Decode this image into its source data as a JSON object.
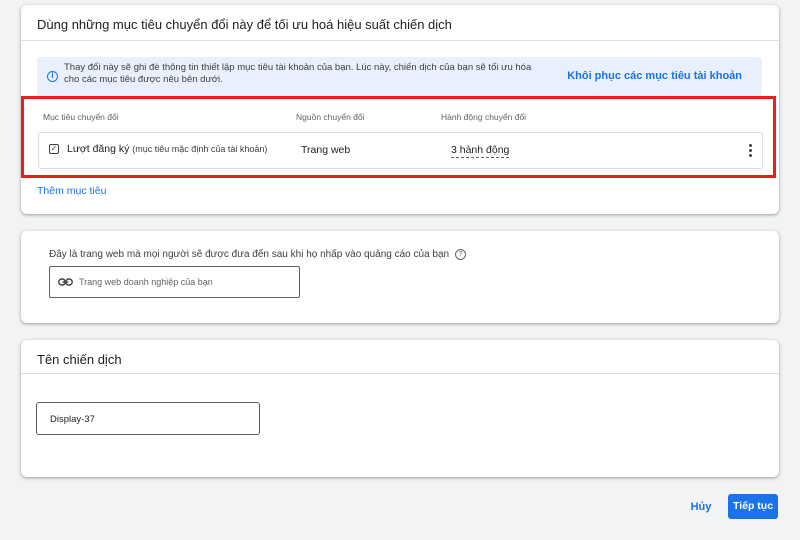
{
  "conversion_card": {
    "title": "Dùng những mục tiêu chuyển đổi này để tối ưu hoá hiệu suất chiến dịch",
    "info_text": "Thay đổi này sẽ ghi đè thông tin thiết lập mục tiêu tài khoản của bạn. Lúc này, chiến dịch của bạn sẽ tối ưu hóa cho các mục tiêu được nêu bên dưới.",
    "restore_link": "Khôi phục các mục tiêu tài khoản",
    "columns": [
      "Mục tiêu chuyển đổi",
      "Nguồn chuyển đổi",
      "Hành động chuyển đổi"
    ],
    "goal": {
      "name": "Lượt đăng ký",
      "note": "(mục tiêu mặc định của tài khoản)",
      "source": "Trang web",
      "action": "3 hành động"
    },
    "add_goal": "Thêm mục tiêu"
  },
  "website_card": {
    "description": "Đây là trang web mà mọi người sẽ được đưa đến sau khi họ nhấp vào quảng cáo của bạn",
    "placeholder": "Trang web doanh nghiệp của bạn"
  },
  "campaign_card": {
    "title": "Tên chiến dịch",
    "value": "Display-37"
  },
  "footer": {
    "cancel": "Hủy",
    "next": "Tiếp tục"
  },
  "colors": {
    "accent": "#1a73e8",
    "highlight": "#e8201c",
    "banner": "#e8f0fe"
  },
  "icons": [
    "info-icon",
    "checkbox-icon",
    "more-vert-icon",
    "help-icon",
    "link-icon"
  ]
}
